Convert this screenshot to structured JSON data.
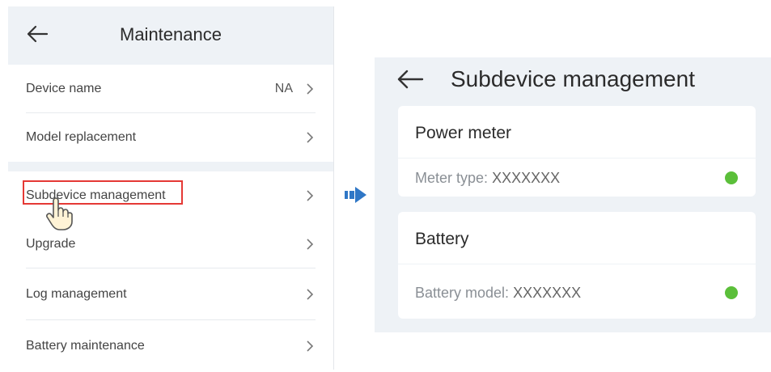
{
  "left": {
    "title": "Maintenance",
    "items": [
      {
        "label": "Device name",
        "value": "NA"
      },
      {
        "label": "Model replacement"
      },
      {
        "label": "Subdevice management"
      },
      {
        "label": "Upgrade"
      },
      {
        "label": "Log management"
      },
      {
        "label": "Battery maintenance"
      }
    ]
  },
  "right": {
    "title": "Subdevice management",
    "cards": [
      {
        "title": "Power meter",
        "detail_label": "Meter type:",
        "detail_value": "XXXXXXX",
        "status_color": "#5bbf3a"
      },
      {
        "title": "Battery",
        "detail_label": "Battery model:",
        "detail_value": "XXXXXXX",
        "status_color": "#5bbf3a"
      }
    ]
  },
  "colors": {
    "highlight": "#e53935",
    "arrow": "#2f77c6",
    "header_bg": "#eef2f6"
  },
  "icons": {
    "back": "back-arrow-icon",
    "chevron": "chevron-right-icon",
    "hand": "hand-pointer-icon",
    "flow": "flow-arrow-icon"
  }
}
